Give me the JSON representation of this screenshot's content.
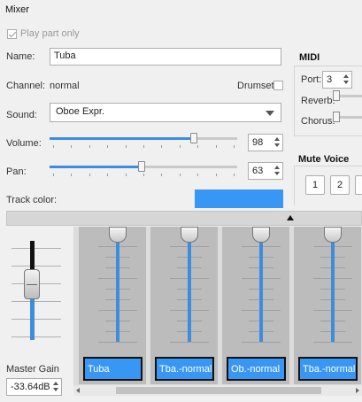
{
  "window": {
    "title": "Mixer"
  },
  "play_part_only": {
    "label": "Play part only",
    "checked": true
  },
  "name": {
    "label": "Name:",
    "value": "Tuba"
  },
  "channel": {
    "label": "Channel:",
    "value": "normal"
  },
  "drumset": {
    "label": "Drumset",
    "checked": false
  },
  "sound": {
    "label": "Sound:",
    "value": "Oboe Expr."
  },
  "volume": {
    "label": "Volume:",
    "value": "98",
    "fraction": 0.78
  },
  "pan": {
    "label": "Pan:",
    "value": "63",
    "fraction": 0.49
  },
  "track_color": {
    "label": "Track color:",
    "color": "#3897f5"
  },
  "midi": {
    "title": "MIDI",
    "port_label": "Port:",
    "port_value": "3",
    "reverb_label": "Reverb:",
    "chorus_label": "Chorus:"
  },
  "mute_voice": {
    "title": "Mute Voice",
    "buttons": [
      "1",
      "2"
    ]
  },
  "master": {
    "label": "Master Gain",
    "value": "-33.64dB"
  },
  "strips": [
    {
      "name": "Tuba"
    },
    {
      "name": "Tba.-normal"
    },
    {
      "name": "Ob.-normal"
    },
    {
      "name": "Tba.-normal"
    }
  ],
  "colors": {
    "accent": "#3c8dde",
    "track": "#3897f5",
    "strip_bg": "#bcbcbc"
  }
}
